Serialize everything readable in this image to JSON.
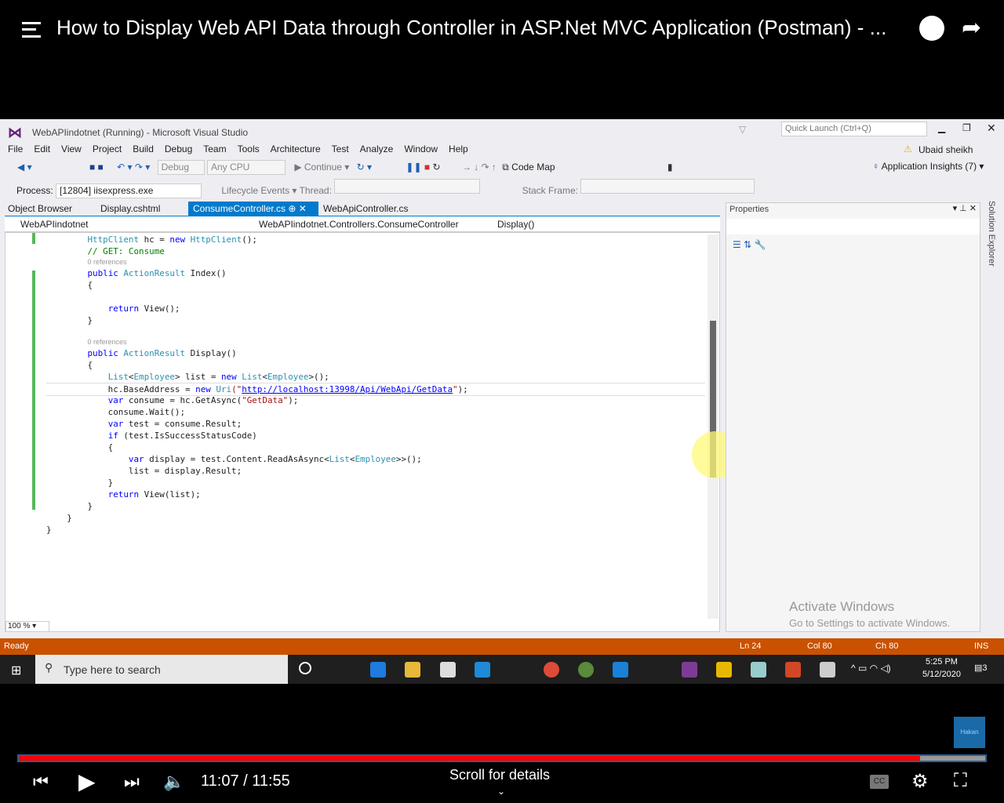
{
  "player": {
    "title": "How to Display Web API Data through Controller in ASP.Net MVC Application (Postman) - ...",
    "time": "11:07 / 11:55",
    "progress": 0.933,
    "scroll_hint": "Scroll for details",
    "watermark": "Hakan"
  },
  "vs": {
    "title": "WebAPIindotnet (Running) - Microsoft Visual Studio",
    "quick_launch": "Quick Launch (Ctrl+Q)",
    "user": "Ubaid sheikh",
    "menu": [
      "File",
      "Edit",
      "View",
      "Project",
      "Build",
      "Debug",
      "Team",
      "Tools",
      "Architecture",
      "Test",
      "Analyze",
      "Window",
      "Help"
    ],
    "toolbar": {
      "config": "Debug",
      "platform": "Any CPU",
      "continue": "Continue",
      "code_map": "Code Map",
      "app_insights": "Application Insights (7)"
    },
    "toolbar2": {
      "process_label": "Process:",
      "process": "[12804] iisexpress.exe",
      "lifecycle": "Lifecycle Events",
      "thread": "Thread:",
      "stack_frame": "Stack Frame:"
    },
    "tabs": [
      "Object Browser",
      "Display.cshtml",
      "ConsumeController.cs",
      "WebApiController.cs"
    ],
    "nav": {
      "project": "WebAPIindotnet",
      "class": "WebAPIindotnet.Controllers.ConsumeController",
      "member": "Display()"
    },
    "zoom": "100 %",
    "properties_title": "Properties",
    "solution_explorer": "Solution Explorer",
    "activate": {
      "title": "Activate Windows",
      "sub": "Go to Settings to activate Windows."
    },
    "status": {
      "ready": "Ready",
      "ln": "Ln 24",
      "col": "Col 80",
      "ch": "Ch 80",
      "ins": "INS"
    },
    "code": [
      [
        [
          "        "
        ],
        [
          "HttpClient",
          "ty"
        ],
        [
          " hc = "
        ],
        [
          "new",
          "kw"
        ],
        [
          " "
        ],
        [
          "HttpClient",
          "ty"
        ],
        [
          "();"
        ]
      ],
      [
        [
          "        "
        ],
        [
          "// GET: Consume",
          "cm"
        ]
      ],
      [
        [
          "        "
        ],
        [
          "0 references",
          "ref"
        ]
      ],
      [
        [
          "        "
        ],
        [
          "public",
          "kw"
        ],
        [
          " "
        ],
        [
          "ActionResult",
          "ty"
        ],
        [
          " Index()"
        ]
      ],
      [
        [
          "        {"
        ]
      ],
      [
        [
          ""
        ]
      ],
      [
        [
          "            "
        ],
        [
          "return",
          "kw"
        ],
        [
          " View();"
        ]
      ],
      [
        [
          "        }"
        ]
      ],
      [
        [
          ""
        ]
      ],
      [
        [
          "        "
        ],
        [
          "0 references",
          "ref"
        ]
      ],
      [
        [
          "        "
        ],
        [
          "public",
          "kw"
        ],
        [
          " "
        ],
        [
          "ActionResult",
          "ty"
        ],
        [
          " Display()"
        ]
      ],
      [
        [
          "        {"
        ]
      ],
      [
        [
          "            "
        ],
        [
          "List",
          "ty"
        ],
        [
          "<"
        ],
        [
          "Employee",
          "ty"
        ],
        [
          "> list = "
        ],
        [
          "new",
          "kw"
        ],
        [
          " "
        ],
        [
          "List",
          "ty"
        ],
        [
          "<"
        ],
        [
          "Employee",
          "ty"
        ],
        [
          ">();"
        ]
      ],
      [
        [
          "            hc.BaseAddress = "
        ],
        [
          "new",
          "kw"
        ],
        [
          " "
        ],
        [
          "Uri",
          "ty"
        ],
        [
          "(\"",
          "st"
        ],
        [
          "http://localhost:13998/Api/WebApi/GetData",
          "url"
        ],
        [
          "\"",
          "st"
        ],
        [
          ");"
        ]
      ],
      [
        [
          "            "
        ],
        [
          "var",
          "kw"
        ],
        [
          " consume = hc.GetAsync("
        ],
        [
          "\"GetData\"",
          "st"
        ],
        [
          ");"
        ]
      ],
      [
        [
          "            consume.Wait();"
        ]
      ],
      [
        [
          "            "
        ],
        [
          "var",
          "kw"
        ],
        [
          " test = consume.Result;"
        ]
      ],
      [
        [
          "            "
        ],
        [
          "if",
          "kw"
        ],
        [
          " (test.IsSuccessStatusCode)"
        ]
      ],
      [
        [
          "            {"
        ]
      ],
      [
        [
          "                "
        ],
        [
          "var",
          "kw"
        ],
        [
          " display = test.Content.ReadAsAsync<"
        ],
        [
          "List",
          "ty"
        ],
        [
          "<"
        ],
        [
          "Employee",
          "ty"
        ],
        [
          ">>();"
        ]
      ],
      [
        [
          "                list = display.Result;"
        ]
      ],
      [
        [
          "            }"
        ]
      ],
      [
        [
          "            "
        ],
        [
          "return",
          "kw"
        ],
        [
          " View(list);"
        ]
      ],
      [
        [
          "        }"
        ]
      ],
      [
        [
          "    }"
        ]
      ],
      [
        [
          "}"
        ]
      ]
    ]
  },
  "taskbar": {
    "search": "Type here to search",
    "time": "5:25 PM",
    "date": "5/12/2020",
    "notifications": "3"
  }
}
